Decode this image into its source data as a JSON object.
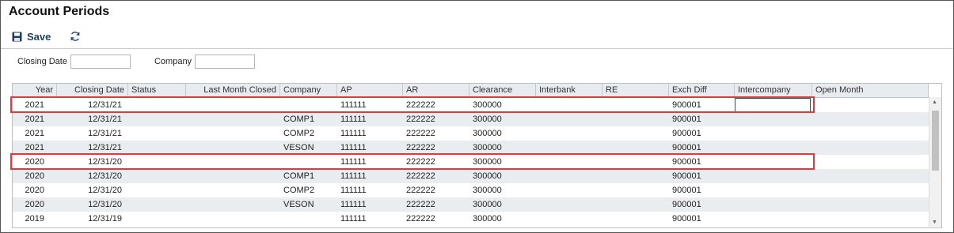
{
  "title": "Account Periods",
  "toolbar": {
    "save_label": "Save",
    "save_icon": "save-icon",
    "refresh_icon": "refresh-icon"
  },
  "filters": {
    "closing_date_label": "Closing Date",
    "closing_date_value": "",
    "company_label": "Company",
    "company_value": ""
  },
  "grid": {
    "columns": [
      "Year",
      "Closing Date",
      "Status",
      "Last Month Closed",
      "Company",
      "AP",
      "AR",
      "Clearance",
      "Interbank",
      "RE",
      "Exch Diff",
      "Intercompany",
      "Open Month"
    ],
    "rows": [
      [
        "2021",
        "12/31/21",
        "",
        "",
        "",
        "111111",
        "222222",
        "300000",
        "",
        "",
        "900001",
        "",
        ""
      ],
      [
        "2021",
        "12/31/21",
        "",
        "",
        "COMP1",
        "111111",
        "222222",
        "300000",
        "",
        "",
        "900001",
        "",
        ""
      ],
      [
        "2021",
        "12/31/21",
        "",
        "",
        "COMP2",
        "111111",
        "222222",
        "300000",
        "",
        "",
        "900001",
        "",
        ""
      ],
      [
        "2021",
        "12/31/21",
        "",
        "",
        "VESON",
        "111111",
        "222222",
        "300000",
        "",
        "",
        "900001",
        "",
        ""
      ],
      [
        "2020",
        "12/31/20",
        "",
        "",
        "",
        "111111",
        "222222",
        "300000",
        "",
        "",
        "900001",
        "",
        ""
      ],
      [
        "2020",
        "12/31/20",
        "",
        "",
        "COMP1",
        "111111",
        "222222",
        "300000",
        "",
        "",
        "900001",
        "",
        ""
      ],
      [
        "2020",
        "12/31/20",
        "",
        "",
        "COMP2",
        "111111",
        "222222",
        "300000",
        "",
        "",
        "900001",
        "",
        ""
      ],
      [
        "2020",
        "12/31/20",
        "",
        "",
        "VESON",
        "111111",
        "222222",
        "300000",
        "",
        "",
        "900001",
        "",
        ""
      ],
      [
        "2019",
        "12/31/19",
        "",
        "",
        "",
        "111111",
        "222222",
        "300000",
        "",
        "",
        "900001",
        "",
        ""
      ]
    ]
  },
  "colors": {
    "highlight": "#e0393e",
    "header_bg": "#e8ecf0",
    "alt_row": "#e9edf0",
    "accent": "#1f3f66"
  }
}
